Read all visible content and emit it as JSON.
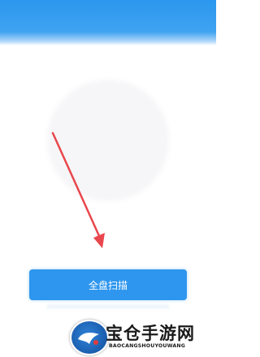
{
  "header": {
    "title": ""
  },
  "main": {
    "scan_button_label": "全盘扫描"
  },
  "annotation": {
    "arrow_color": "#e8474d"
  },
  "watermark": {
    "title": "宝仓手游网",
    "subtitle": "BAOCANGSHOUYOUWANG"
  },
  "colors": {
    "accent": "#2e96ee",
    "header": "#2b97ee"
  }
}
